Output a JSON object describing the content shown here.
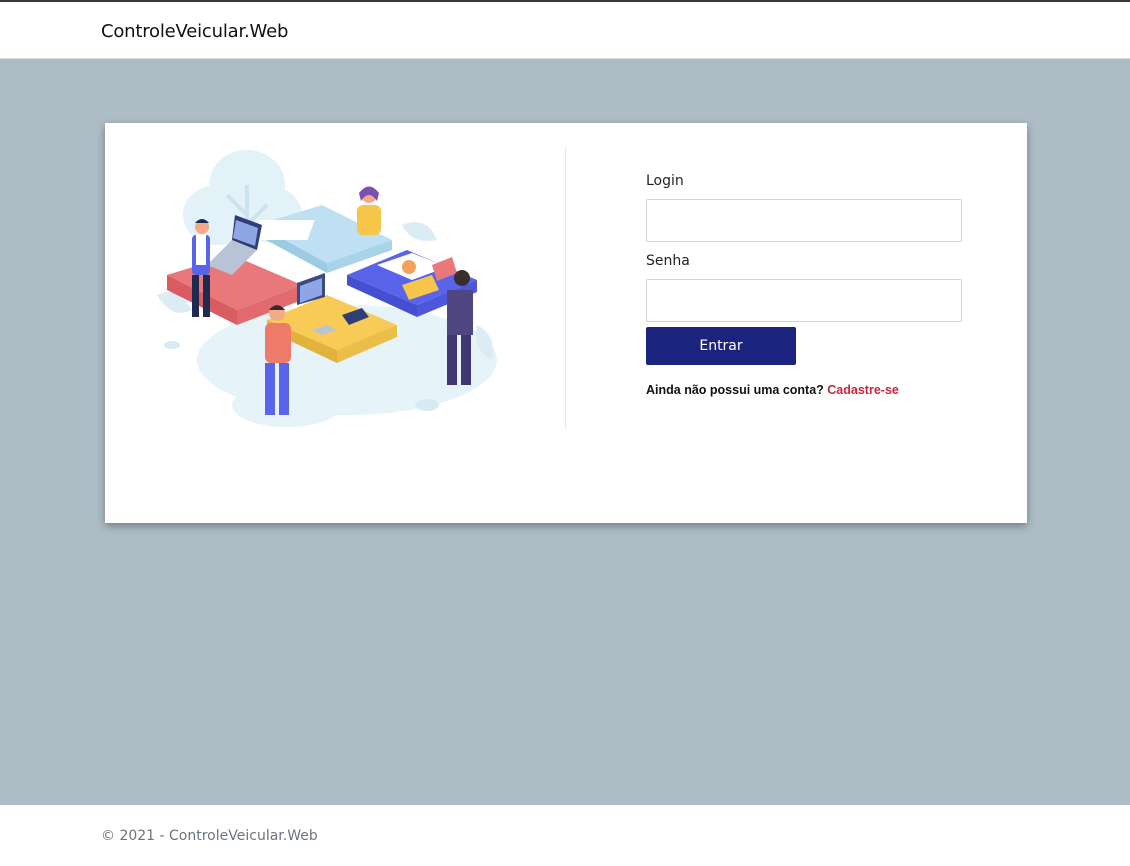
{
  "header": {
    "brand": "ControleVeicular.Web"
  },
  "login_form": {
    "login_label": "Login",
    "login_value": "",
    "senha_label": "Senha",
    "senha_value": "",
    "submit_label": "Entrar",
    "signup_prompt": "Ainda não possui uma conta?",
    "signup_link": "Cadastre-se"
  },
  "footer": {
    "text": "© 2021 - ControleVeicular.Web"
  },
  "colors": {
    "page_background": "#aebdc5",
    "primary_button": "#1a237e",
    "link": "#c62839"
  },
  "illustration": {
    "icon": "teamwork-puzzle-illustration"
  }
}
